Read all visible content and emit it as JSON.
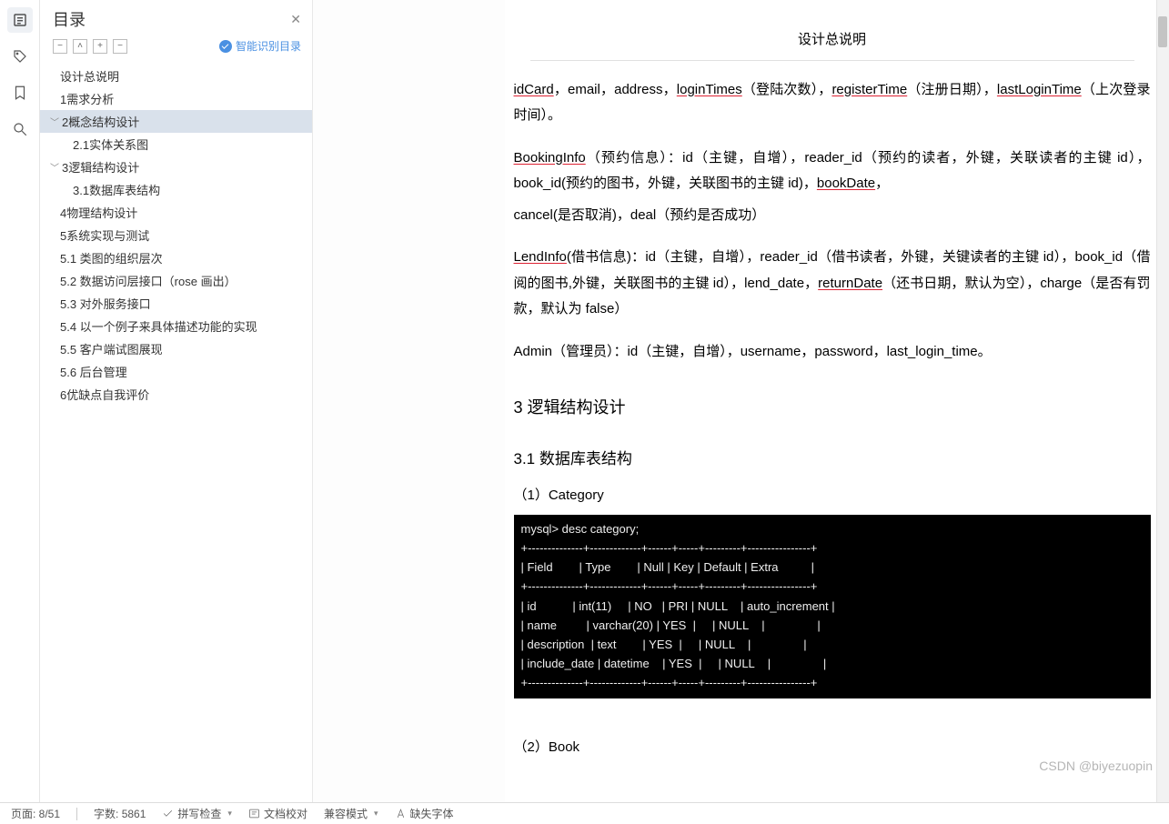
{
  "outline": {
    "title": "目录",
    "smart_label": "智能识别目录",
    "items": [
      {
        "label": "设计总说明"
      },
      {
        "label": "1需求分析"
      },
      {
        "label": "2概念结构设计"
      },
      {
        "label": "2.1实体关系图"
      },
      {
        "label": "3逻辑结构设计"
      },
      {
        "label": "3.1数据库表结构"
      },
      {
        "label": "4物理结构设计"
      },
      {
        "label": "5系统实现与测试"
      },
      {
        "label": "5.1  类图的组织层次"
      },
      {
        "label": "5.2  数据访问层接口（rose 画出）"
      },
      {
        "label": "5.3  对外服务接口"
      },
      {
        "label": "5.4  以一个例子来具体描述功能的实现"
      },
      {
        "label": "5.5  客户端试图展现"
      },
      {
        "label": "5.6  后台管理"
      },
      {
        "label": "6优缺点自我评价"
      }
    ]
  },
  "doc": {
    "page_title": "设计总说明",
    "p1": {
      "a": "idCard",
      "b": "，email，address，",
      "c": "loginTimes",
      "d": "（登陆次数），",
      "e": "registerTime",
      "f": "（注册日期），",
      "g": "lastLoginTime",
      "h": "（上次登录时间）。"
    },
    "p2": {
      "a": "BookingInfo",
      "b": "（预约信息）：id（主键，自增），reader_id（预约的读者，外键，关联读者的主键 id），book_id(预约的图书，外键，关联图书的主键 id)，",
      "c": "",
      "d": "",
      "e": "bookDate",
      "f": "，"
    },
    "p3": "cancel(是否取消)，deal（预约是否成功）",
    "p4": {
      "a": "LendInfo",
      "b": "(借书信息)：id（主键，自增），reader_id（借书读者，外键，关键读者的主键 id），book_id（借阅的图书,外键，关联图书的主键 id），lend_date，",
      "c": "",
      "d": "",
      "e": "returnDate",
      "f": "（还书日期，默认为空），charge（是否有罚款，默认为 false）"
    },
    "p5": "Admin（管理员）：id（主键，自增），username，password，last_login_time。",
    "h3": "3   逻辑结构设计",
    "h31": "3.1 数据库表结构",
    "cat": "（1）Category",
    "term": "mysql> desc category;\n+--------------+-------------+------+-----+---------+----------------+\n| Field        | Type        | Null | Key | Default | Extra          |\n+--------------+-------------+------+-----+---------+----------------+\n| id           | int(11)     | NO   | PRI | NULL    | auto_increment |\n| name         | varchar(20) | YES  |     | NULL    |                |\n| description  | text        | YES  |     | NULL    |                |\n| include_date | datetime    | YES  |     | NULL    |                |\n+--------------+-------------+------+-----+---------+----------------+",
    "book": "（2）Book"
  },
  "status": {
    "page": "页面: 8/51",
    "words": "字数: 5861",
    "spell": "拼写检查",
    "proof": "文档校对",
    "compat": "兼容模式",
    "font": "缺失字体"
  },
  "watermark": "CSDN @biyezuopin",
  "chart_data": {
    "type": "table",
    "title": "desc category",
    "columns": [
      "Field",
      "Type",
      "Null",
      "Key",
      "Default",
      "Extra"
    ],
    "rows": [
      [
        "id",
        "int(11)",
        "NO",
        "PRI",
        "NULL",
        "auto_increment"
      ],
      [
        "name",
        "varchar(20)",
        "YES",
        "",
        "NULL",
        ""
      ],
      [
        "description",
        "text",
        "YES",
        "",
        "NULL",
        ""
      ],
      [
        "include_date",
        "datetime",
        "YES",
        "",
        "NULL",
        ""
      ]
    ]
  }
}
